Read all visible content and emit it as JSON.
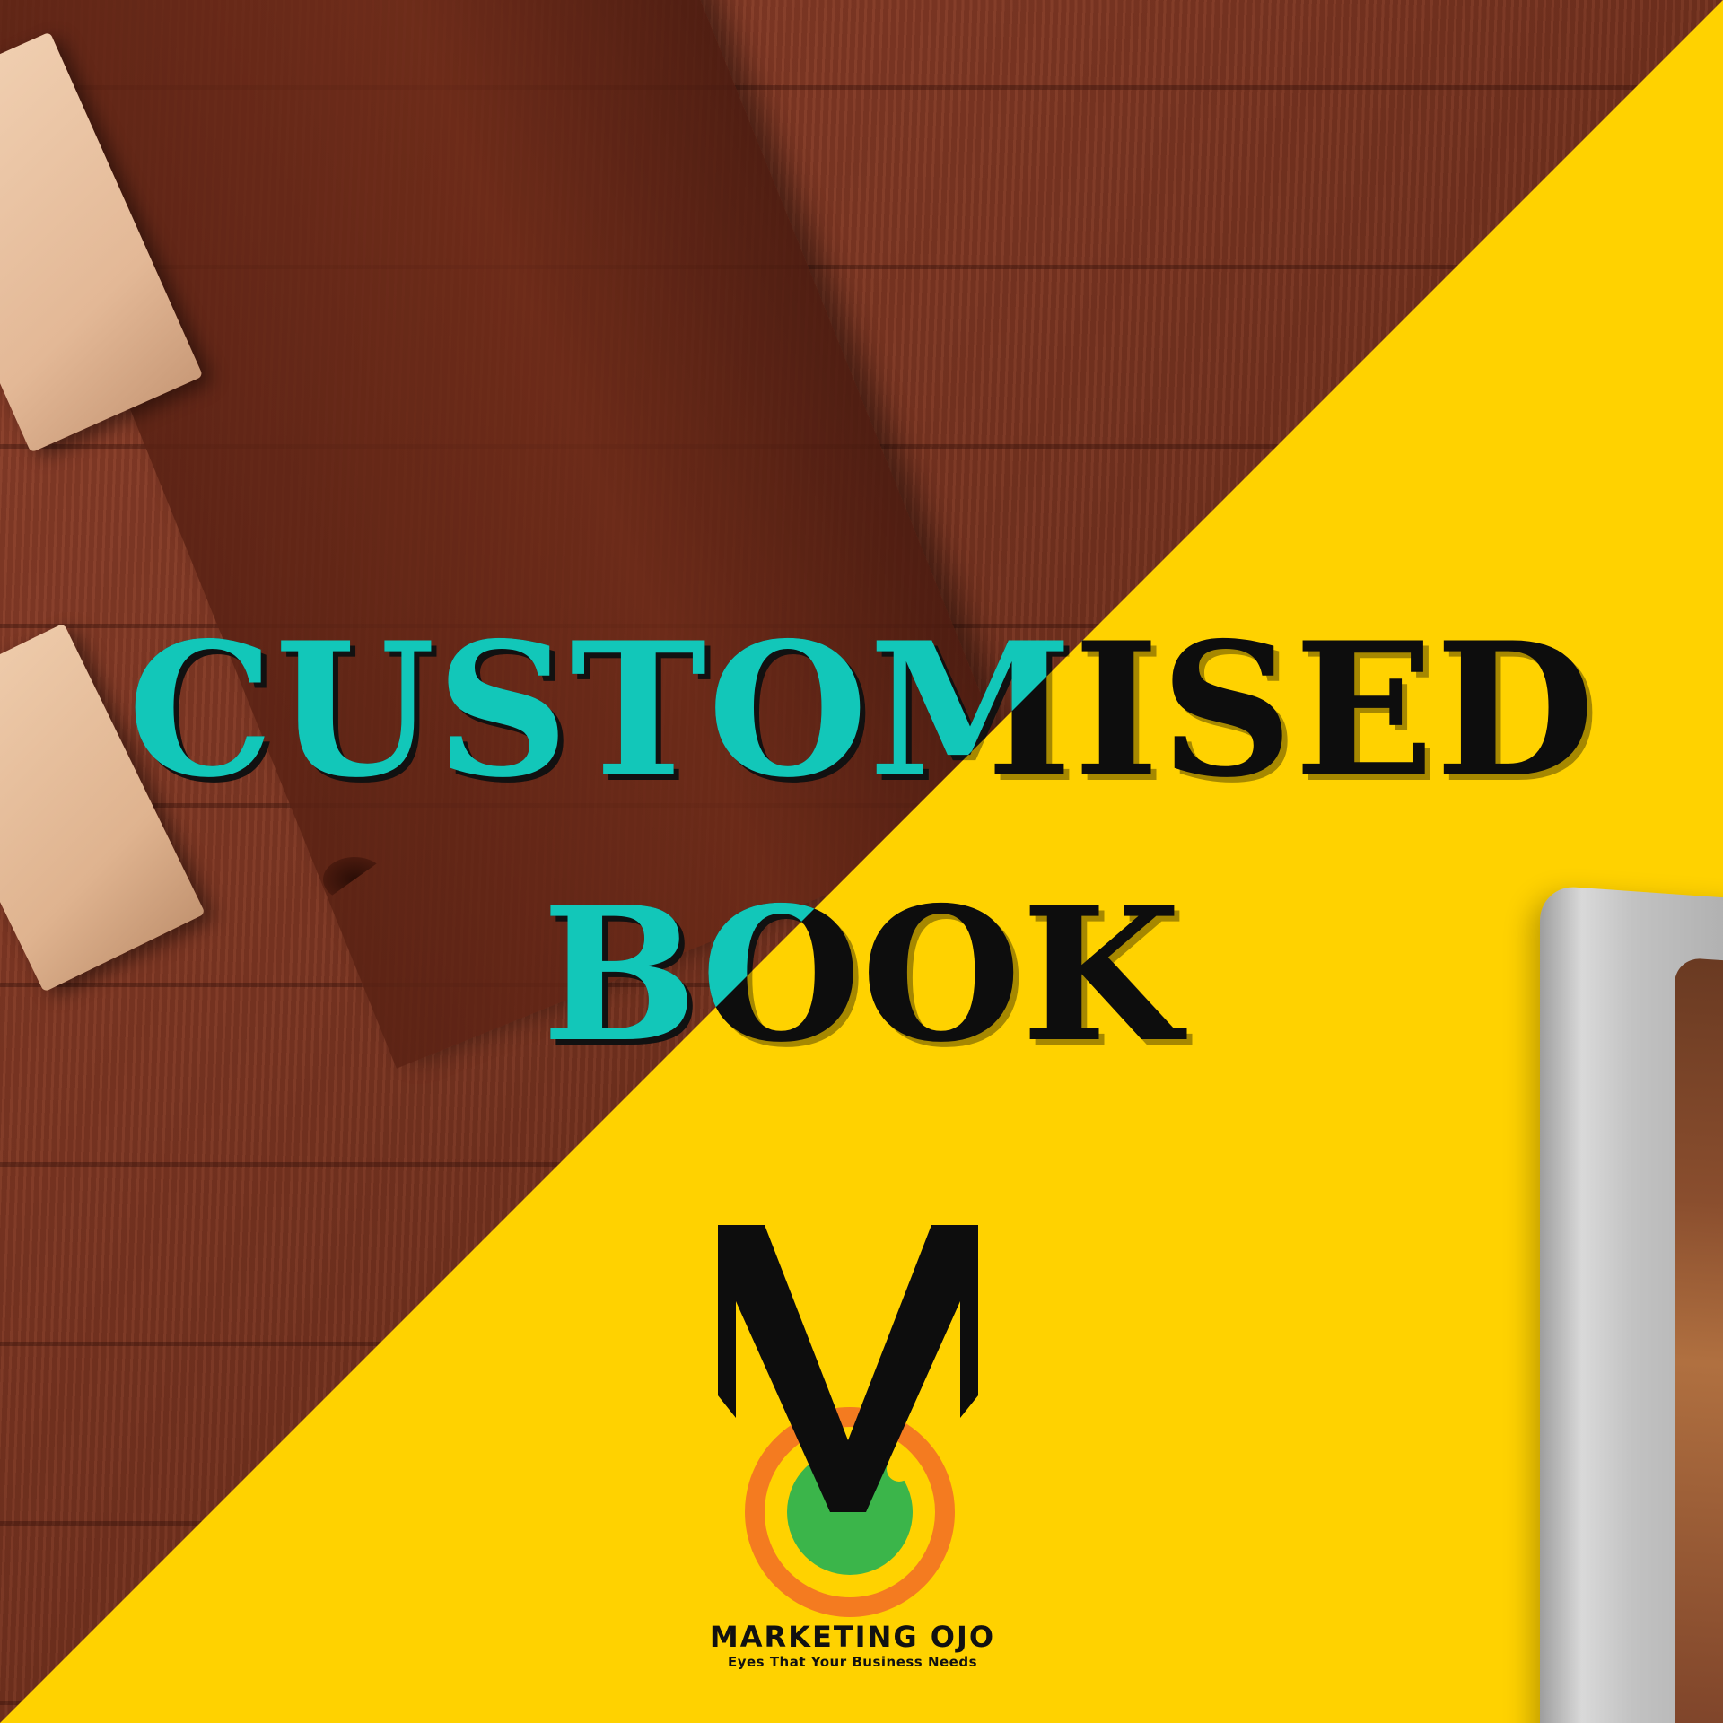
{
  "headline": {
    "line1": "CUSTOMISED",
    "line2": "BOOK"
  },
  "brand": {
    "logo_letter": "M",
    "name": "MARKETING OJO",
    "tagline": "Eyes That Your Business Needs"
  },
  "colors": {
    "background_yellow": "#ffd200",
    "headline_teal": "#12c7b9",
    "headline_black": "#0d0d0d",
    "logo_orange": "#f47b20",
    "logo_green": "#3bb54a"
  },
  "icons": [
    "marketing-ojo-logo",
    "book-mockup"
  ]
}
